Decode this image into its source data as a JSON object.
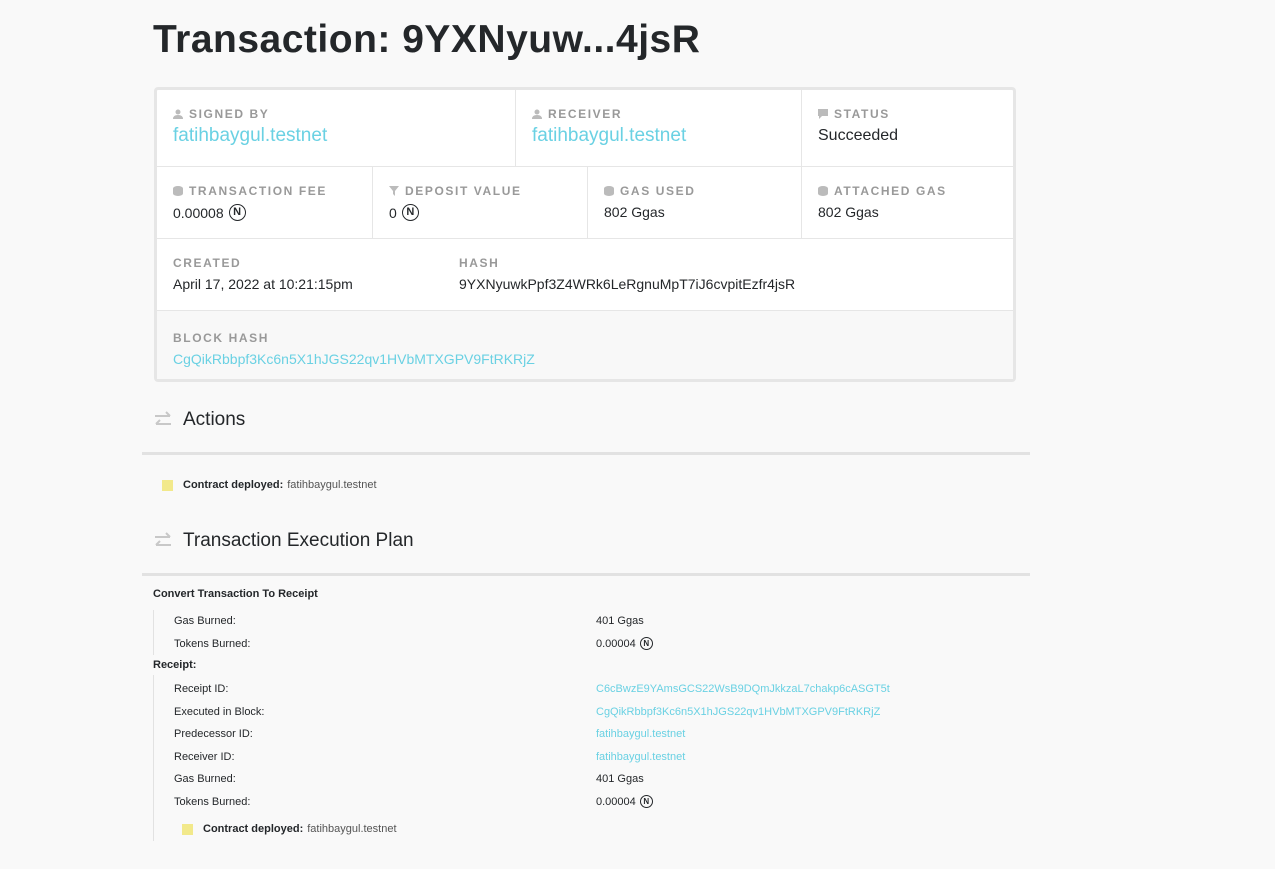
{
  "title": "Transaction: 9YXNyuw...4jsR",
  "overview": {
    "signed_by_label": "SIGNED BY",
    "signed_by": "fatihbaygul.testnet",
    "receiver_label": "RECEIVER",
    "receiver": "fatihbaygul.testnet",
    "status_label": "STATUS",
    "status": "Succeeded",
    "fee_label": "TRANSACTION FEE",
    "fee": "0.00008",
    "deposit_label": "DEPOSIT VALUE",
    "deposit": "0",
    "gas_used_label": "GAS USED",
    "gas_used": "802 Ggas",
    "attached_gas_label": "ATTACHED GAS",
    "attached_gas": "802 Ggas",
    "created_label": "CREATED",
    "created": "April 17, 2022 at 10:21:15pm",
    "hash_label": "HASH",
    "hash": "9YXNyuwkPpf3Z4WRk6LeRgnuMpT7iJ6cvpitEzfr4jsR",
    "block_hash_label": "BLOCK HASH",
    "block_hash": "CgQikRbbpf3Kc6n5X1hJGS22qv1HVbMTXGPV9FtRKRjZ",
    "near_symbol": "N"
  },
  "actions": {
    "heading": "Actions",
    "items": [
      {
        "label": "Contract deployed:",
        "account": "fatihbaygul.testnet"
      }
    ]
  },
  "plan": {
    "heading": "Transaction Execution Plan",
    "convert_title": "Convert Transaction To Receipt",
    "convert_rows": [
      {
        "key": "Gas Burned:",
        "value": "401 Ggas"
      },
      {
        "key": "Tokens Burned:",
        "value": "0.00004"
      }
    ],
    "receipt_title": "Receipt:",
    "receipt_rows": [
      {
        "key": "Receipt ID:",
        "value": "C6cBwzE9YAmsGCS22WsB9DQmJkkzaL7chakp6cASGT5t"
      },
      {
        "key": "Executed in Block:",
        "value": "CgQikRbbpf3Kc6n5X1hJGS22qv1HVbMTXGPV9FtRKRjZ"
      },
      {
        "key": "Predecessor ID:",
        "value": "fatihbaygul.testnet"
      },
      {
        "key": "Receiver ID:",
        "value": "fatihbaygul.testnet"
      },
      {
        "key": "Gas Burned:",
        "value": "401 Ggas"
      },
      {
        "key": "Tokens Burned:",
        "value": "0.00004"
      }
    ],
    "receipt_action": {
      "label": "Contract deployed:",
      "account": "fatihbaygul.testnet"
    }
  },
  "colors": {
    "link": "#6ad1e3",
    "text": "#24272a",
    "label": "#999999",
    "doc_icon": "#f2e98b"
  }
}
